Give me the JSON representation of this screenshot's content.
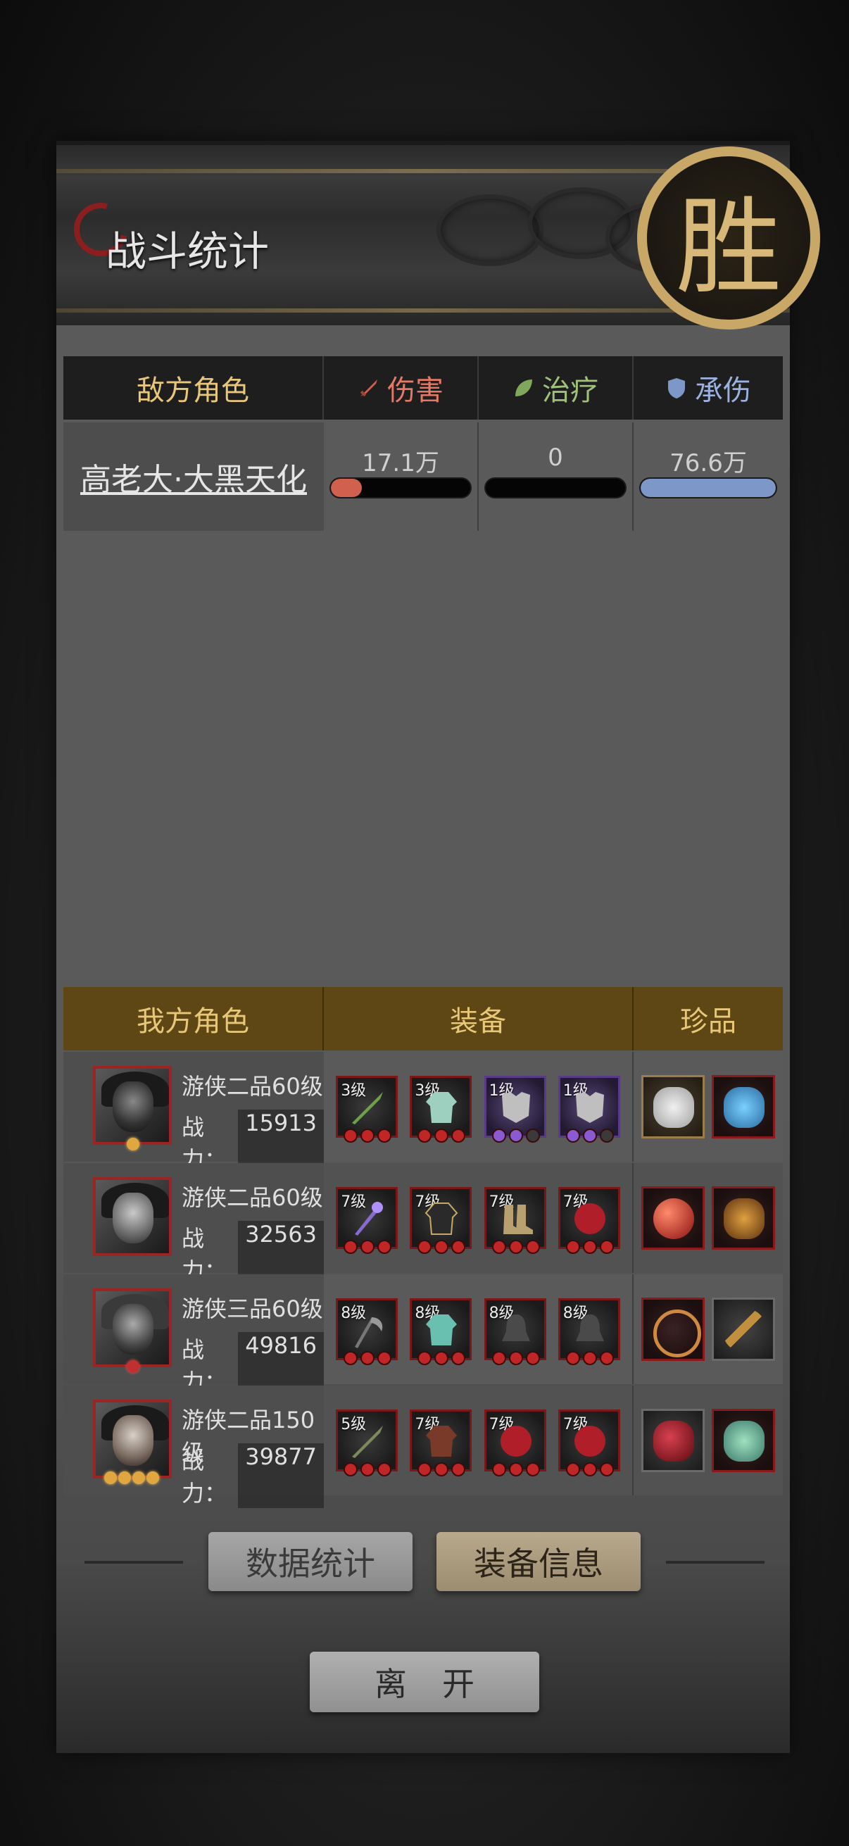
{
  "title": "战斗统计",
  "seal_char": "胜",
  "enemy_table": {
    "headers": {
      "role": "敌方角色",
      "damage": "伤害",
      "heal": "治疗",
      "taken": "承伤"
    },
    "rows": [
      {
        "name": "高老大·大黑天化",
        "damage": "17.1万",
        "heal": "0",
        "taken": "76.6万",
        "damage_fraction": 0.22,
        "heal_fraction": 0,
        "taken_fraction": 1.0
      }
    ]
  },
  "ally_table": {
    "headers": {
      "role": "我方角色",
      "equip": "装备",
      "treasure": "珍品"
    },
    "power_label": "战力：",
    "rows": [
      {
        "class": "游侠二品60级",
        "power": "15913",
        "equip_levels": [
          "3级",
          "3级",
          "1级",
          "1级"
        ]
      },
      {
        "class": "游侠二品60级",
        "power": "32563",
        "equip_levels": [
          "7级",
          "7级",
          "7级",
          "7级"
        ]
      },
      {
        "class": "游侠三品60级",
        "power": "49816",
        "equip_levels": [
          "8级",
          "8级",
          "8级",
          "8级"
        ]
      },
      {
        "class": "游侠二品150级",
        "power": "39877",
        "equip_levels": [
          "5级",
          "7级",
          "7级",
          "7级"
        ]
      }
    ]
  },
  "buttons": {
    "data_stats": "数据统计",
    "equip_info": "装备信息",
    "leave": "离开"
  },
  "colors": {
    "damage": "#e47a66",
    "heal": "#9ec27a",
    "taken": "#9ab2e0",
    "damage_bar": "#d2604f",
    "taken_bar": "#7d97c8",
    "ally_header": "#5e4714"
  }
}
